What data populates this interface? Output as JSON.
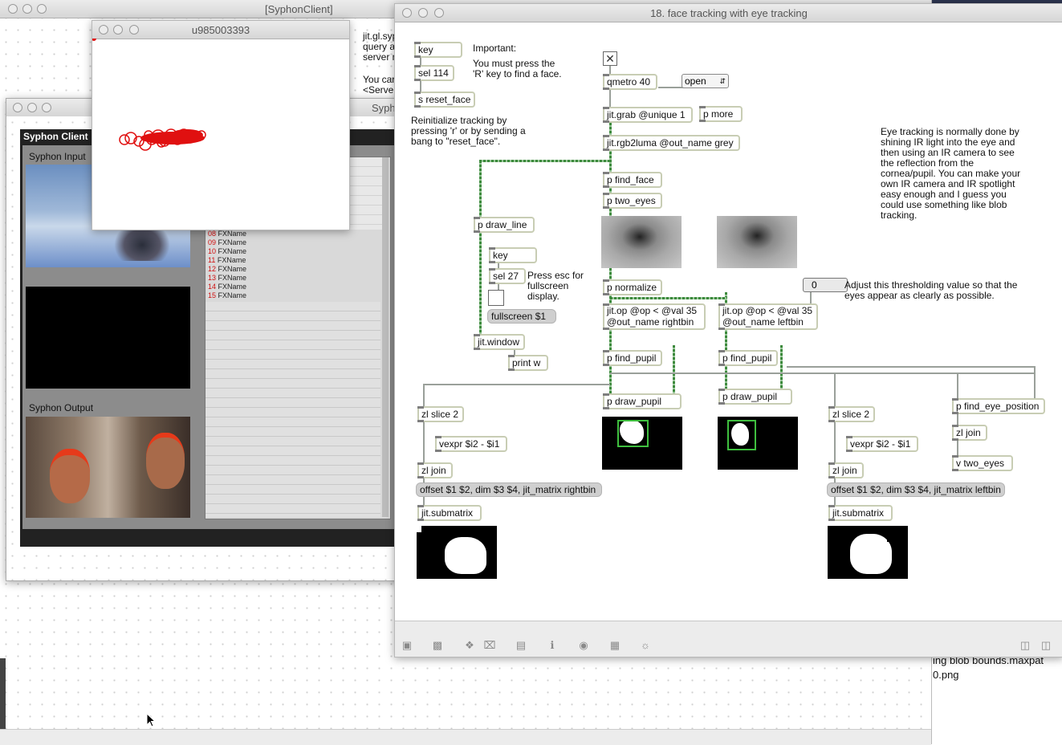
{
  "windows": {
    "syphon_client_main": {
      "title": "[SyphonClient]"
    },
    "syphon_client_behind": {
      "title": "Syph"
    },
    "u_window": {
      "title": "u985003393"
    },
    "patcher": {
      "title": "18. face tracking with eye tracking"
    }
  },
  "behind_text": {
    "line1": "jit.gl.syp",
    "line2": "query a",
    "line3": "server n",
    "line4": "You car",
    "line5": "<Server"
  },
  "syphon_client": {
    "header": "Syphon Client",
    "input_label": "Syphon Input",
    "output_label": "Syphon Output",
    "fx_list": [
      {
        "num": "08",
        "name": "FXName"
      },
      {
        "num": "09",
        "name": "FXName"
      },
      {
        "num": "10",
        "name": "FXName"
      },
      {
        "num": "11",
        "name": "FXName"
      },
      {
        "num": "12",
        "name": "FXName"
      },
      {
        "num": "13",
        "name": "FXName"
      },
      {
        "num": "14",
        "name": "FXName"
      },
      {
        "num": "15",
        "name": "FXName"
      }
    ]
  },
  "files": {
    "file1": "ing blob bounds.maxpat",
    "file2": "0.png"
  },
  "patch": {
    "key1": "key",
    "sel114": "sel 114",
    "reset_face": "s reset_face",
    "important": "Important:",
    "press_r": "You must press the\n'R' key to find a face.",
    "reinit": "Reinitialize tracking by\npressing 'r' or by sending a\nbang to \"reset_face\".",
    "qmetro": "qmetro 40",
    "open_menu": "open",
    "jit_grab": "jit.grab @unique 1",
    "p_more": "p more",
    "rgb2luma": "jit.rgb2luma @out_name grey",
    "find_face": "p find_face",
    "two_eyes": "p two_eyes",
    "draw_line": "p draw_line",
    "key2": "key",
    "sel27": "sel 27",
    "esc_comment": "Press esc for\nfullscreen\ndisplay.",
    "fullscreen": "fullscreen $1",
    "jit_window": "jit.window",
    "print_w": "print w",
    "normalize": "p normalize",
    "threshold_value": "0",
    "threshold_comment": "Adjust this thresholding value so that the\neyes appear as clearly as possible.",
    "jitop_right": "jit.op @op < @val 35\n@out_name rightbin",
    "jitop_left": "jit.op @op < @val 35\n@out_name leftbin",
    "find_pupil_r": "p find_pupil",
    "find_pupil_l": "p find_pupil",
    "draw_pupil_r": "p draw_pupil",
    "draw_pupil_l": "p draw_pupil",
    "eye_comment": "Eye tracking is normally done by\nshining IR light into the eye and\nthen using an IR camera to see\nthe reflection from the\ncornea/pupil. You can make your\nown IR camera and IR spotlight\neasy enough and I guess you\ncould use something like blob\ntracking.",
    "zl_slice_r": "zl slice 2",
    "vexpr_r": "vexpr $i2 - $i1",
    "zl_join_r": "zl join",
    "offset_r": "offset $1 $2, dim $3 $4, jit_matrix rightbin",
    "submatrix_r": "jit.submatrix",
    "zl_slice_l": "zl slice 2",
    "vexpr_l": "vexpr $i2 - $i1",
    "zl_join_l": "zl join",
    "offset_l": "offset $1 $2, dim $3 $4, jit_matrix leftbin",
    "submatrix_l": "jit.submatrix",
    "find_eye_pos": "p find_eye_position",
    "zl_join_e": "zl join",
    "v_two_eyes": "v two_eyes"
  },
  "toolbar_icons": [
    "lock-icon",
    "presentation-icon",
    "patch-cord-icon",
    "close-patch-icon",
    "inspector-icon",
    "info-icon",
    "segment-icon",
    "grid-icon",
    "palette-icon",
    "left-pane-icon",
    "right-pane-icon"
  ]
}
